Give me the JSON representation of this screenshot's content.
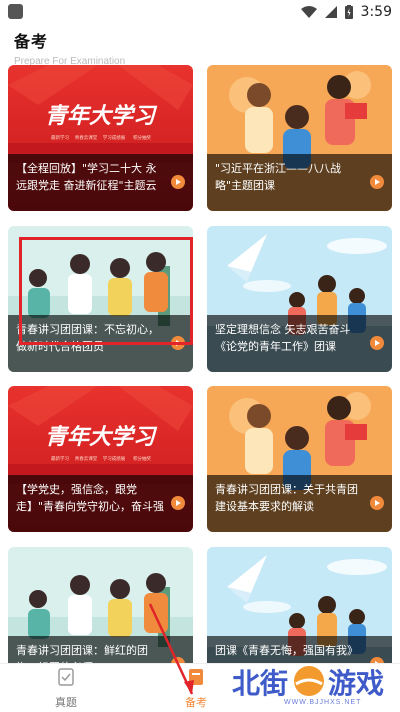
{
  "status_bar": {
    "time": "3:59"
  },
  "header": {
    "title": "备考",
    "subtitle": "Prepare For Examination"
  },
  "cards": [
    {
      "title": "【全程回放】\"学习二十大 永远跟党走 奋进新征程\"主题云团课",
      "theme": "youth-study",
      "banner_text": "青年大学习",
      "menu": [
        "最新学习",
        "青春云课堂",
        "学习成绩展",
        "积分抽奖"
      ]
    },
    {
      "title": "\"习近平在浙江——八八战略\"主题团课",
      "theme": "readers"
    },
    {
      "title": "青春讲习团团课：不忘初心，做新时代合格团员",
      "theme": "runners"
    },
    {
      "title": "坚定理想信念 矢志艰苦奋斗《论党的青年工作》团课",
      "theme": "plane"
    },
    {
      "title": "【学党史，强信念，跟党走】\"青春向党守初心，奋斗强国勇担...",
      "theme": "youth-study",
      "banner_text": "青年大学习",
      "menu": [
        "最新学习",
        "青春云课堂",
        "学习成绩展",
        "积分抽奖"
      ]
    },
    {
      "title": "青春讲习团团课：关于共青团建设基本要求的解读",
      "theme": "readers"
    },
    {
      "title": "青春讲习团团课：鲜红的团旗，祖国的必须",
      "theme": "runners"
    },
    {
      "title": "团课《青春无悔，强国有我》",
      "theme": "plane"
    }
  ],
  "bottom_nav": {
    "tabs": [
      {
        "label": "真题"
      },
      {
        "label": "备考"
      }
    ]
  },
  "watermark": {
    "part1": "北街",
    "part2": "游戏",
    "url": "WWW.BJJHXS.NET"
  },
  "colors": {
    "accent": "#f28a3c",
    "highlight": "#e0242a",
    "red_banner": "#d81f24",
    "orange_bg": "#f6a35a",
    "sky_blue": "#bfe6f7"
  }
}
